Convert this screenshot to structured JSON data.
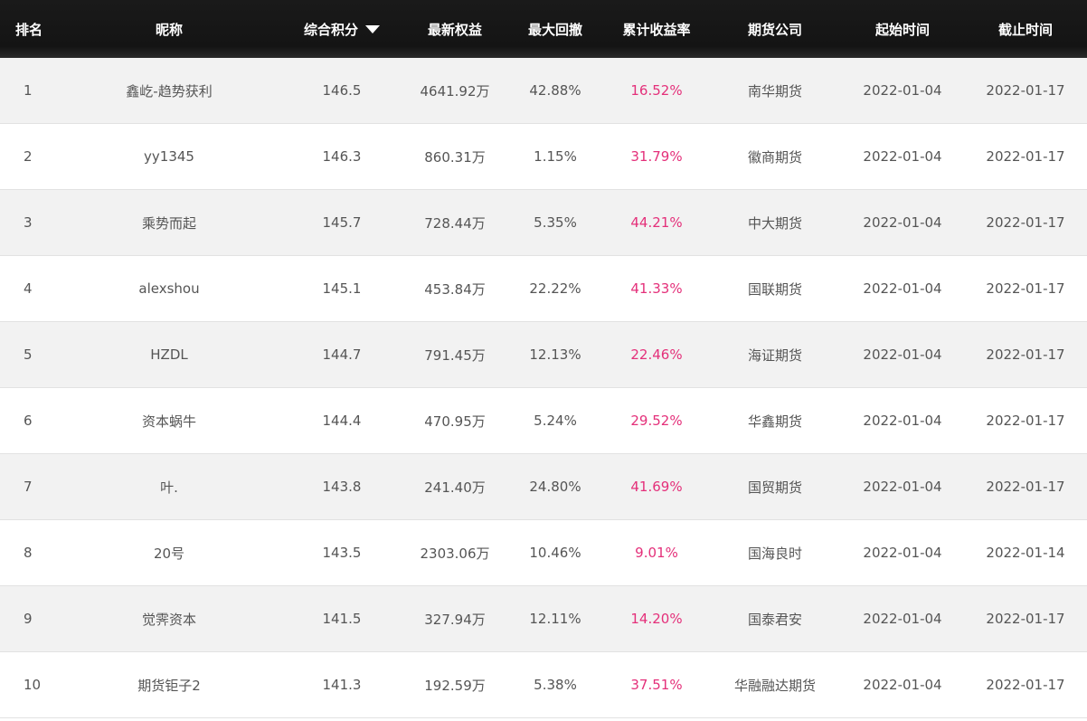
{
  "columns": {
    "rank": "排名",
    "nickname": "昵称",
    "score": "综合积分",
    "equity": "最新权益",
    "drawdown": "最大回撤",
    "return_rate": "累计收益率",
    "broker": "期货公司",
    "start": "起始时间",
    "end": "截止时间"
  },
  "sort": {
    "column": "score",
    "direction": "desc",
    "icon": "sort-desc-icon"
  },
  "colors": {
    "header_bg": "#141414",
    "accent_rate": "#e4307a",
    "row_alt": "#f2f2f2"
  },
  "rows": [
    {
      "rank": "1",
      "nickname": "鑫屹-趋势获利",
      "score": "146.5",
      "equity": "4641.92万",
      "drawdown": "42.88%",
      "return_rate": "16.52%",
      "broker": "南华期货",
      "start": "2022-01-04",
      "end": "2022-01-17"
    },
    {
      "rank": "2",
      "nickname": "yy1345",
      "score": "146.3",
      "equity": "860.31万",
      "drawdown": "1.15%",
      "return_rate": "31.79%",
      "broker": "徽商期货",
      "start": "2022-01-04",
      "end": "2022-01-17"
    },
    {
      "rank": "3",
      "nickname": "乘势而起",
      "score": "145.7",
      "equity": "728.44万",
      "drawdown": "5.35%",
      "return_rate": "44.21%",
      "broker": "中大期货",
      "start": "2022-01-04",
      "end": "2022-01-17"
    },
    {
      "rank": "4",
      "nickname": "alexshou",
      "score": "145.1",
      "equity": "453.84万",
      "drawdown": "22.22%",
      "return_rate": "41.33%",
      "broker": "国联期货",
      "start": "2022-01-04",
      "end": "2022-01-17"
    },
    {
      "rank": "5",
      "nickname": "HZDL",
      "score": "144.7",
      "equity": "791.45万",
      "drawdown": "12.13%",
      "return_rate": "22.46%",
      "broker": "海证期货",
      "start": "2022-01-04",
      "end": "2022-01-17"
    },
    {
      "rank": "6",
      "nickname": "资本蜗牛",
      "score": "144.4",
      "equity": "470.95万",
      "drawdown": "5.24%",
      "return_rate": "29.52%",
      "broker": "华鑫期货",
      "start": "2022-01-04",
      "end": "2022-01-17"
    },
    {
      "rank": "7",
      "nickname": "叶.",
      "score": "143.8",
      "equity": "241.40万",
      "drawdown": "24.80%",
      "return_rate": "41.69%",
      "broker": "国贸期货",
      "start": "2022-01-04",
      "end": "2022-01-17"
    },
    {
      "rank": "8",
      "nickname": "20号",
      "score": "143.5",
      "equity": "2303.06万",
      "drawdown": "10.46%",
      "return_rate": "9.01%",
      "broker": "国海良时",
      "start": "2022-01-04",
      "end": "2022-01-14"
    },
    {
      "rank": "9",
      "nickname": "觉霁资本",
      "score": "141.5",
      "equity": "327.94万",
      "drawdown": "12.11%",
      "return_rate": "14.20%",
      "broker": "国泰君安",
      "start": "2022-01-04",
      "end": "2022-01-17"
    },
    {
      "rank": "10",
      "nickname": "期货钜子2",
      "score": "141.3",
      "equity": "192.59万",
      "drawdown": "5.38%",
      "return_rate": "37.51%",
      "broker": "华融融达期货",
      "start": "2022-01-04",
      "end": "2022-01-17"
    }
  ]
}
